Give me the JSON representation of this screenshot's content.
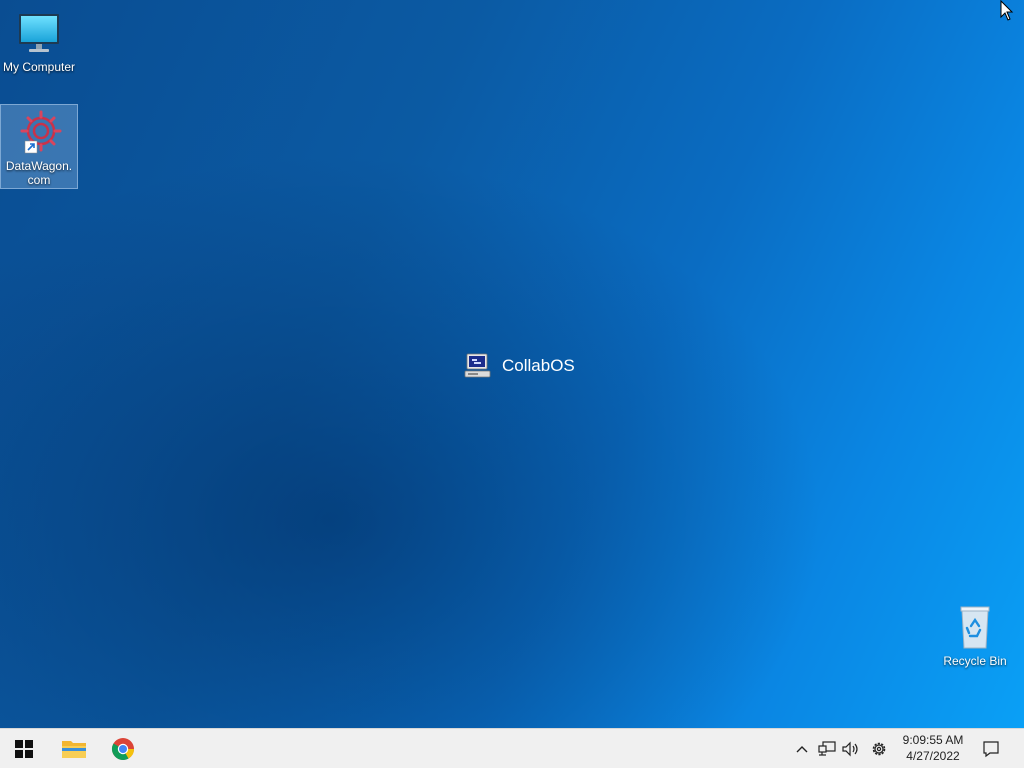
{
  "desktop": {
    "icons": [
      {
        "label": "My Computer"
      },
      {
        "label": "DataWagon.com"
      },
      {
        "label": "Recycle Bin"
      }
    ],
    "center_logo_text": "CollabOS"
  },
  "taskbar": {
    "start": "start-icon",
    "pinned": [
      "file-explorer-icon",
      "chrome-icon"
    ],
    "tray_icons": [
      "chevron-up-icon",
      "network-icon",
      "volume-icon",
      "settings-icon"
    ],
    "time": "9:09:55 AM",
    "date": "4/27/2022",
    "notification": "notification-icon"
  },
  "colors": {
    "taskbar_bg": "#f0f0f0",
    "desktop_accent": "#0a6cc2",
    "start_blue": "#1e5ea8"
  }
}
